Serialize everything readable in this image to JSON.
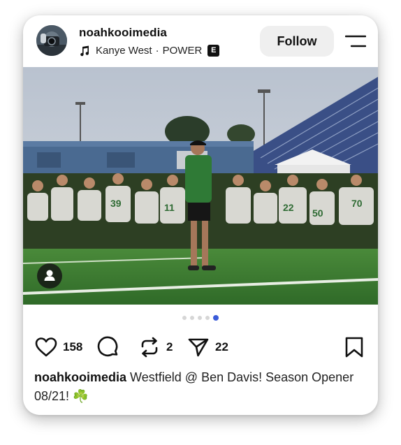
{
  "post": {
    "username": "noahkooimedia",
    "music": {
      "artist": "Kanye West",
      "separator": "·",
      "track": "POWER",
      "explicit_badge": "E"
    },
    "follow_label": "Follow",
    "carousel": {
      "total_slides": 5,
      "active_slide": 5
    },
    "actions": {
      "likes": "158",
      "reposts": "2",
      "shares": "22"
    },
    "caption": {
      "username": "noahkooimedia",
      "text_before": "Westfield",
      "threads_glyph": "@",
      "text_after": "Ben Davis! Season Opener 08/21!",
      "emoji": "☘️"
    }
  },
  "colors": {
    "active_dot": "#3a5bd9",
    "inactive_dot": "#d6d6d6",
    "follow_bg": "#efefef",
    "jersey_green": "#2f7a36",
    "field_green": "#3f7d33"
  },
  "icons": [
    "music-note-icon",
    "menu-icon",
    "user-tag-icon",
    "heart-icon",
    "comment-icon",
    "repost-icon",
    "share-icon",
    "bookmark-icon"
  ]
}
